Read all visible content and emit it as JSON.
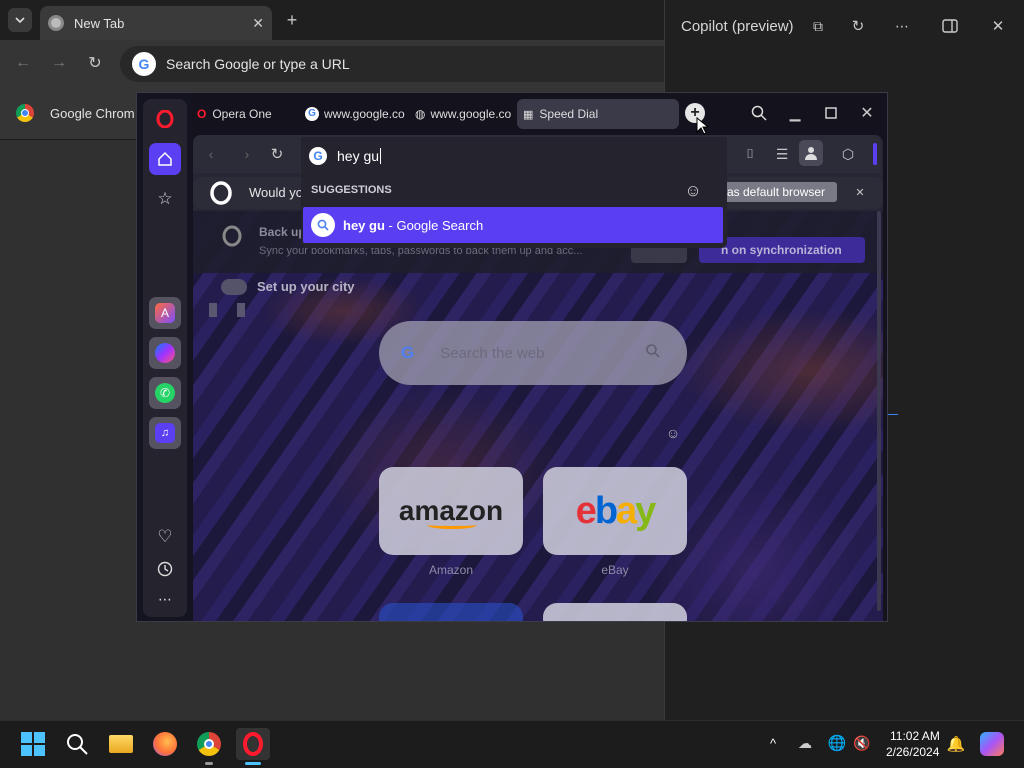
{
  "chrome": {
    "tab_title": "New Tab",
    "omnibox_placeholder": "Search Google or type a URL",
    "bookmark_label": "Google Chrom"
  },
  "copilot": {
    "title": "Copilot (preview)"
  },
  "opera": {
    "tabs": [
      {
        "label": "Opera One"
      },
      {
        "label": "www.google.co"
      },
      {
        "label": "www.google.co"
      },
      {
        "label": "Speed Dial"
      }
    ],
    "address_value": "hey gu",
    "banner": {
      "text": "Would yo",
      "default_button": "as default browser"
    },
    "sync": {
      "title": "Back up",
      "subtitle": "Sync your bookmarks, tabs, passwords to back them up and acc...",
      "button": "n on synchronization"
    },
    "city_label": "Set up your city",
    "search_placeholder": "Search the web",
    "suggestions": {
      "header": "SUGGESTIONS",
      "item_bold": "hey gu",
      "item_rest": " - Google Search"
    },
    "speed_dial": [
      {
        "logo": "amazon",
        "label": "Amazon"
      },
      {
        "logo": "ebay",
        "label": "eBay"
      }
    ]
  },
  "taskbar": {
    "time": "11:02 AM",
    "date": "2/26/2024"
  }
}
